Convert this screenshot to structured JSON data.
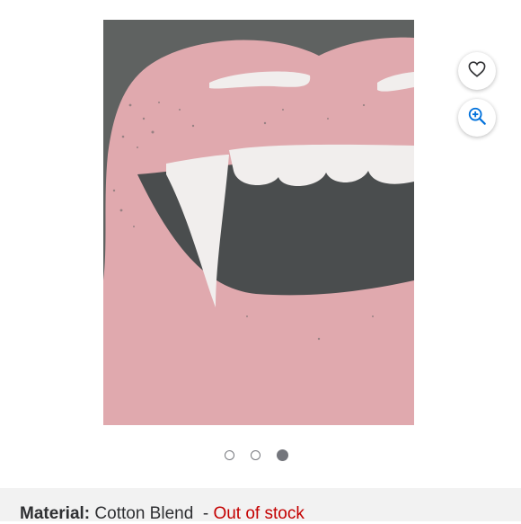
{
  "image_gallery": {
    "dots": [
      {
        "active": false
      },
      {
        "active": false
      },
      {
        "active": true
      }
    ]
  },
  "actions": {
    "favorite_icon": "heart-icon",
    "zoom_icon": "zoom-in-icon"
  },
  "product_info": {
    "material_label": "Material:",
    "material_value": "Cotton Blend",
    "separator": "-",
    "stock_status": "Out of stock"
  },
  "colors": {
    "shirt_gray": "#5f6261",
    "lip_pink": "#e0a9ae",
    "stock_red": "#c40000",
    "active_dot": "#74767c",
    "accent_blue": "#0071dc"
  }
}
